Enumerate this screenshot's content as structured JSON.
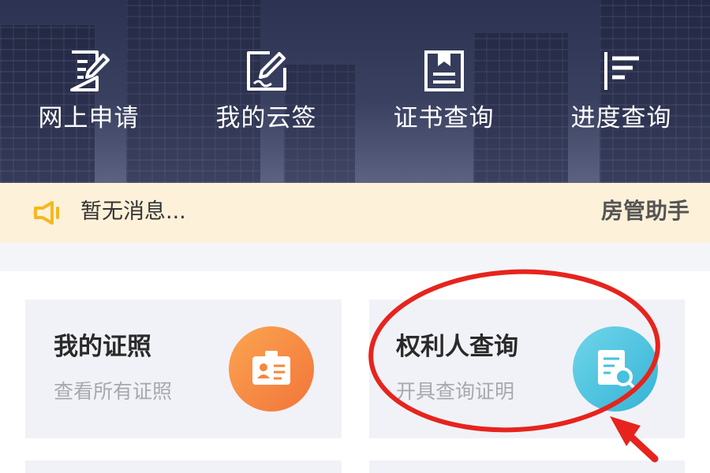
{
  "quick_actions": [
    {
      "label": "网上申请",
      "icon": "edit-form-icon"
    },
    {
      "label": "我的云签",
      "icon": "pen-sign-icon"
    },
    {
      "label": "证书查询",
      "icon": "certificate-icon"
    },
    {
      "label": "进度查询",
      "icon": "progress-bars-icon"
    }
  ],
  "notice": {
    "text": "暂无消息...",
    "icon": "speaker-icon",
    "assistant_label": "房管助手",
    "accent": "#f5b81f"
  },
  "cards": [
    {
      "title": "我的证照",
      "subtitle": "查看所有证照",
      "icon": "id-card-icon",
      "color": "#f5873a"
    },
    {
      "title": "权利人查询",
      "subtitle": "开具查询证明",
      "icon": "document-search-icon",
      "color": "#46c1dc"
    }
  ],
  "annotation": {
    "color": "#e6241d",
    "shape": "ellipse-with-arrow"
  }
}
